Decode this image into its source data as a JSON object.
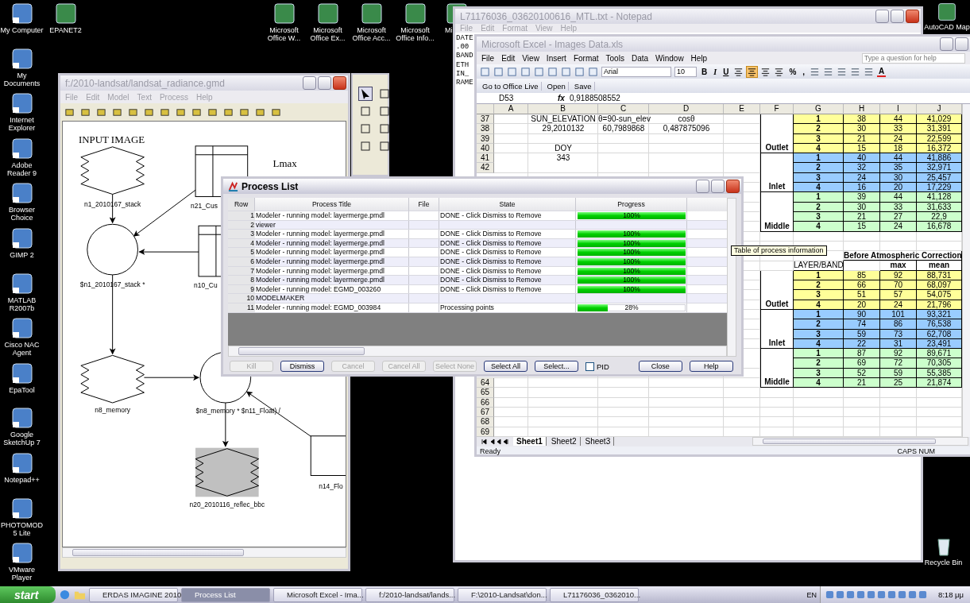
{
  "desktop": {
    "left_icons": [
      "My Computer",
      "My Documents",
      "Internet Explorer",
      "Adobe Reader 9",
      "Browser Choice",
      "GIMP 2",
      "MATLAB R2007b",
      "Cisco NAC Agent",
      "EpaTool",
      "Google SketchUp 7",
      "Notepad++",
      "PHOTOMOD 5 Lite",
      "VMware Player"
    ],
    "top_icons": [
      "EPANET2",
      "Microsoft Office W...",
      "Microsoft Office Ex...",
      "Microsoft Office Acc...",
      "Microsoft Office Info...",
      "Mi",
      "AutoCAD Map"
    ],
    "recycle_bin": "Recycle Bin"
  },
  "model_window": {
    "title": "f:/2010-landsat/landsat_radiance.gmd",
    "menu": [
      "File",
      "Edit",
      "Model",
      "Text",
      "Process",
      "Help"
    ],
    "headings": [
      "INPUT IMAGE",
      "Lmax"
    ],
    "nodes": [
      {
        "kind": "raster",
        "label": "n1_2010167_stack"
      },
      {
        "kind": "table",
        "label": "n21_Cus"
      },
      {
        "kind": "function",
        "label": "$n1_2010167_stack *"
      },
      {
        "kind": "table",
        "label": "n10_Cu"
      },
      {
        "kind": "raster",
        "label": "n8_memory"
      },
      {
        "kind": "function",
        "label": "$n8_memory * $n11_Float) /"
      },
      {
        "kind": "output",
        "label": "n20_2010116_reflec_bbc"
      },
      {
        "kind": "scalar",
        "label": "n14_Flo"
      }
    ]
  },
  "notepad": {
    "title": "L71176036_03620100616_MTL.txt - Notepad",
    "menu": [
      "File",
      "Edit",
      "Format",
      "View",
      "Help"
    ],
    "lines": [
      "DATE",
      ".00",
      "BAND",
      "ETH",
      "IN_",
      "RAME"
    ]
  },
  "excel": {
    "title": "Microsoft Excel - Images Data.xls",
    "menu": [
      "File",
      "Edit",
      "View",
      "Insert",
      "Format",
      "Tools",
      "Data",
      "Window",
      "Help"
    ],
    "help_placeholder": "Type a question for help",
    "font": "Arial",
    "font_size": "10",
    "format_buttons": [
      "B",
      "I",
      "U"
    ],
    "align_buttons": [
      {
        "selected": false
      },
      {
        "selected": true
      },
      {
        "selected": false
      },
      {
        "selected": false
      }
    ],
    "number_buttons": [
      "%",
      ","
    ],
    "font_color_button": "A",
    "office_live": [
      "Go to Office Live",
      "Open",
      "Save"
    ],
    "name_box": "D53",
    "fx": "fx",
    "formula": "0,9188508552",
    "columns": [
      "A",
      "B",
      "C",
      "D",
      "E",
      "F",
      "G",
      "H",
      "I",
      "J"
    ],
    "rows": [
      {
        "row": "37",
        "cells": {
          "B": "SUN_ELEVATION",
          "C": "θ=90-sun_elev",
          "D": "cosθ",
          "G": "1",
          "H": "38",
          "I": "44",
          "J": "41,029"
        },
        "color": "#ffff99"
      },
      {
        "row": "38",
        "cells": {
          "B": "29,2010132",
          "C": "60,7989868",
          "D": "0,487875096",
          "G": "2",
          "H": "30",
          "I": "33",
          "J": "31,391"
        },
        "color": "#ffff99"
      },
      {
        "row": "39",
        "cells": {
          "G": "3",
          "H": "21",
          "I": "24",
          "J": "22,599"
        },
        "color": "#ffff99"
      },
      {
        "row": "40",
        "cells": {
          "B": "DOY",
          "F": "Outlet",
          "G": "4",
          "H": "15",
          "I": "18",
          "J": "16,372"
        },
        "color": "#ffff99"
      },
      {
        "row": "41",
        "cells": {
          "B": "343",
          "G": "1",
          "H": "40",
          "I": "44",
          "J": "41,886"
        },
        "color": "#99ccff"
      },
      {
        "row": "42",
        "cells": {
          "G": "2",
          "H": "32",
          "I": "35",
          "J": "32,971"
        },
        "color": "#99ccff"
      },
      {
        "cells": {
          "G": "3",
          "H": "24",
          "I": "30",
          "J": "25,457"
        },
        "color": "#99ccff"
      },
      {
        "cells": {
          "F": "Inlet",
          "G": "4",
          "H": "16",
          "I": "20",
          "J": "17,229"
        },
        "color": "#99ccff"
      },
      {
        "cells": {
          "G": "1",
          "H": "39",
          "I": "44",
          "J": "41,128"
        },
        "color": "#ccffcc"
      },
      {
        "cells": {
          "G": "2",
          "H": "30",
          "I": "33",
          "J": "31,633"
        },
        "color": "#ccffcc"
      },
      {
        "cells": {
          "G": "3",
          "H": "21",
          "I": "27",
          "J": "22,9"
        },
        "color": "#ccffcc"
      },
      {
        "cells": {
          "F": "Middle",
          "G": "4",
          "H": "15",
          "I": "24",
          "J": "16,678"
        },
        "color": "#ccffcc"
      },
      {
        "cells": {}
      },
      {
        "cells": {}
      },
      {
        "kind": "banner",
        "text": "Before Atmospheric Correction",
        "cells": {}
      },
      {
        "kind": "header",
        "cells": {
          "G": "LAYER/BAND",
          "I": "max",
          "J": "mean"
        }
      },
      {
        "cells": {
          "G": "1",
          "H": "85",
          "I": "92",
          "J": "88,731"
        },
        "color": "#ffff99"
      },
      {
        "cells": {
          "G": "2",
          "H": "66",
          "I": "70",
          "J": "68,097"
        },
        "color": "#ffff99"
      },
      {
        "cells": {
          "G": "3",
          "H": "51",
          "I": "57",
          "J": "54,075"
        },
        "color": "#ffff99"
      },
      {
        "cells": {
          "F": "Outlet",
          "G": "4",
          "H": "20",
          "I": "24",
          "J": "21,796"
        },
        "color": "#ffff99"
      },
      {
        "cells": {
          "G": "1",
          "H": "90",
          "I": "101",
          "J": "93,321"
        },
        "color": "#99ccff"
      },
      {
        "cells": {
          "G": "2",
          "H": "74",
          "I": "86",
          "J": "76,538"
        },
        "color": "#99ccff"
      },
      {
        "cells": {
          "G": "3",
          "H": "59",
          "I": "73",
          "J": "62,708"
        },
        "color": "#99ccff"
      },
      {
        "cells": {
          "F": "Inlet",
          "G": "4",
          "H": "22",
          "I": "31",
          "J": "23,491"
        },
        "color": "#99ccff"
      },
      {
        "cells": {
          "G": "1",
          "H": "87",
          "I": "92",
          "J": "89,671"
        },
        "color": "#ccffcc"
      },
      {
        "cells": {
          "G": "2",
          "H": "69",
          "I": "72",
          "J": "70,305"
        },
        "color": "#ccffcc"
      },
      {
        "cells": {
          "G": "3",
          "H": "52",
          "I": "59",
          "J": "55,385"
        },
        "color": "#ccffcc"
      },
      {
        "row": "64",
        "cells": {
          "F": "Middle",
          "G": "4",
          "H": "21",
          "I": "25",
          "J": "21,874"
        },
        "color": "#ccffcc"
      },
      {
        "row": "65",
        "cells": {}
      },
      {
        "row": "66",
        "cells": {}
      },
      {
        "row": "67",
        "cells": {}
      },
      {
        "row": "68",
        "cells": {}
      },
      {
        "row": "69",
        "cells": {}
      }
    ],
    "tooltip": "Table of process information",
    "sheets": [
      {
        "label": "Sheet1",
        "selected": true
      },
      {
        "label": "Sheet2",
        "selected": false
      },
      {
        "label": "Sheet3",
        "selected": false
      }
    ],
    "status": "Ready",
    "indicators": "CAPS NUM"
  },
  "process_list": {
    "title": "Process List",
    "columns": [
      "Row",
      "Process Title",
      "File",
      "State",
      "Progress"
    ],
    "rows": [
      {
        "row": "1",
        "title": "Modeler - running model: layermerge.pmdl",
        "state": "DONE - Click Dismiss to Remove",
        "level": 1,
        "percent": "100%"
      },
      {
        "row": "2",
        "title": "viewer"
      },
      {
        "row": "3",
        "title": "Modeler - running model: layermerge.pmdl",
        "state": "DONE - Click Dismiss to Remove",
        "level": 1,
        "percent": "100%"
      },
      {
        "row": "4",
        "title": "Modeler - running model: layermerge.pmdl",
        "state": "DONE - Click Dismiss to Remove",
        "level": 1,
        "percent": "100%"
      },
      {
        "row": "5",
        "title": "Modeler - running model: layermerge.pmdl",
        "state": "DONE - Click Dismiss to Remove",
        "level": 1,
        "percent": "100%"
      },
      {
        "row": "6",
        "title": "Modeler - running model: layermerge.pmdl",
        "state": "DONE - Click Dismiss to Remove",
        "level": 1,
        "percent": "100%"
      },
      {
        "row": "7",
        "title": "Modeler - running model: layermerge.pmdl",
        "state": "DONE - Click Dismiss to Remove",
        "level": 1,
        "percent": "100%"
      },
      {
        "row": "8",
        "title": "Modeler - running model: layermerge.pmdl",
        "state": "DONE - Click Dismiss to Remove",
        "level": 1,
        "percent": "100%"
      },
      {
        "row": "9",
        "title": "Modeler - running model: EGMD_003260",
        "state": "DONE - Click Dismiss to Remove",
        "level": 1,
        "percent": "100%"
      },
      {
        "row": "10",
        "title": "MODELMAKER"
      },
      {
        "row": "11",
        "title": "Modeler - running model: EGMD_003984",
        "state": "Processing points",
        "level": 0.28,
        "percent": "28%"
      }
    ],
    "controls": [
      {
        "kind": "button",
        "label": "Kill",
        "disabled": true
      },
      {
        "kind": "button",
        "label": "Dismiss",
        "disabled": false
      },
      {
        "kind": "button",
        "label": "Cancel",
        "disabled": true
      },
      {
        "kind": "button",
        "label": "Cancel All",
        "disabled": true
      },
      {
        "kind": "button",
        "label": "Select None",
        "disabled": true
      },
      {
        "kind": "button",
        "label": "Select All",
        "disabled": false
      },
      {
        "kind": "button",
        "label": "Select...",
        "disabled": false
      },
      {
        "kind": "checkbox",
        "label": "PID",
        "checked": false
      },
      {
        "kind": "button",
        "label": "Close",
        "disabled": false
      },
      {
        "kind": "button",
        "label": "Help",
        "disabled": false
      }
    ]
  },
  "taskbar": {
    "start": "start",
    "tasks": [
      {
        "label": "ERDAS IMAGINE 2010",
        "selected": false
      },
      {
        "label": "Process List",
        "selected": true
      },
      {
        "label": "Microsoft Excel - Ima...",
        "selected": false
      },
      {
        "label": "f:/2010-landsat/lands...",
        "selected": false
      },
      {
        "label": "F:\\2010-Landsat\\don...",
        "selected": false
      },
      {
        "label": "L71176036_0362010...",
        "selected": false
      }
    ],
    "language": "EN",
    "clock": "8:18 μμ"
  }
}
